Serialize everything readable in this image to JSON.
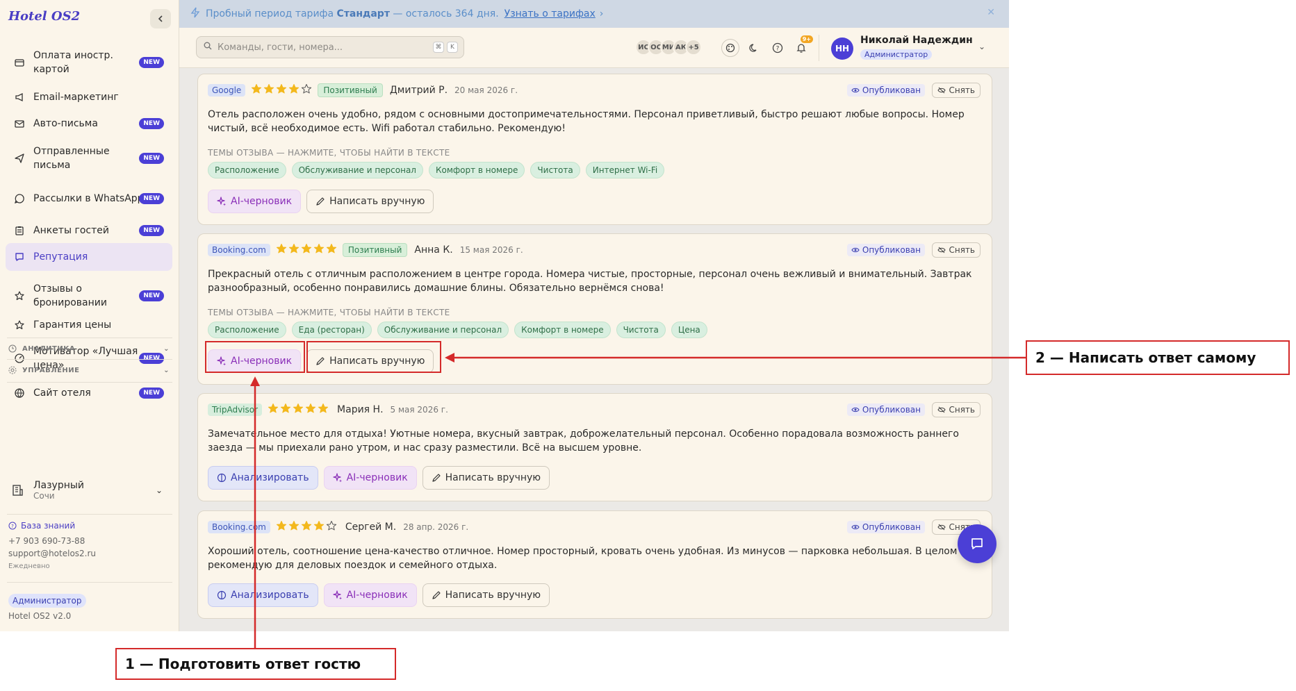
{
  "app": {
    "brand": "Hotel OS2"
  },
  "sidebar": {
    "items": [
      {
        "label": "Оплата иностр. картой",
        "icon": "credit-card-icon",
        "new": true
      },
      {
        "label": "Email-маркетинг",
        "icon": "megaphone-icon",
        "new": false
      },
      {
        "label": "Авто-письма",
        "icon": "mail-icon",
        "new": true
      },
      {
        "label": "Отправленные письма",
        "icon": "send-icon",
        "new": true
      },
      {
        "label": "Рассылки в WhatsApp",
        "icon": "chat-bubble-icon",
        "new": true
      },
      {
        "label": "Анкеты гостей",
        "icon": "clipboard-icon",
        "new": true
      },
      {
        "label": "Репутация",
        "icon": "message-square-icon",
        "new": false,
        "active": true
      },
      {
        "label": "Отзывы о бронировании",
        "icon": "star-icon",
        "new": true
      },
      {
        "label": "Гарантия цены",
        "icon": "star-outline-icon",
        "new": false
      },
      {
        "label": "Мотиватор «Лучшая цена»",
        "icon": "gauge-icon",
        "new": true
      },
      {
        "label": "Сайт отеля",
        "icon": "globe-icon",
        "new": true
      }
    ],
    "new_badge": "NEW",
    "sections": {
      "analytics": "АНАЛИТИКА",
      "management": "УПРАВЛЕНИЕ"
    },
    "hotel": {
      "name": "Лазурный",
      "city": "Сочи"
    },
    "footer": {
      "kb_link": "База знаний",
      "phone": "+7 903 690-73-88",
      "email": "support@hotelos2.ru",
      "hours": "Ежедневно",
      "role": "Администратор",
      "version": "Hotel OS2 v2.0"
    }
  },
  "banner": {
    "prefix": "Пробный период тарифа",
    "plan": "Стандарт",
    "suffix": "— осталось 364 дня.",
    "link": "Узнать о тарифах",
    "link_arrow": "›"
  },
  "topbar": {
    "search_placeholder": "Команды, гости, номера...",
    "kbd1": "⌘",
    "kbd2": "K",
    "avatars": [
      "ИС",
      "ОС",
      "МИ",
      "АК",
      "+5"
    ],
    "notif_badge": "9+",
    "user": {
      "initials": "НН",
      "name": "Николай Надеждин",
      "role": "Администратор"
    }
  },
  "labels": {
    "status": "Опубликован",
    "unpublish": "Снять",
    "themes": "ТЕМЫ ОТЗЫВА — НАЖМИТЕ, ЧТОБЫ НАЙТИ В ТЕКСТЕ",
    "ai_draft": "AI-черновик",
    "manual": "Написать вручную",
    "analyze": "Анализировать"
  },
  "reviews": [
    {
      "source": "Google",
      "rating": 4,
      "sentiment": "Позитивный",
      "author": "Дмитрий Р.",
      "date": "20 мая 2026 г.",
      "text": "Отель расположен очень удобно, рядом с основными достопримечательностями. Персонал приветливый, быстро решают любые вопросы. Номер чистый, всё необходимое есть. Wifi работал стабильно. Рекомендую!",
      "tags": [
        "Расположение",
        "Обслуживание и персонал",
        "Комфорт в номере",
        "Чистота",
        "Интернет Wi-Fi"
      ]
    },
    {
      "source": "Booking.com",
      "rating": 5,
      "sentiment": "Позитивный",
      "author": "Анна К.",
      "date": "15 мая 2026 г.",
      "text": "Прекрасный отель с отличным расположением в центре города. Номера чистые, просторные, персонал очень вежливый и внимательный. Завтрак разнообразный, особенно понравились домашние блины. Обязательно вернёмся снова!",
      "tags": [
        "Расположение",
        "Еда (ресторан)",
        "Обслуживание и персонал",
        "Комфорт в номере",
        "Чистота",
        "Цена"
      ]
    },
    {
      "source": "TripAdvisor",
      "rating": 5,
      "sentiment": "",
      "author": "Мария Н.",
      "date": "5 мая 2026 г.",
      "text": "Замечательное место для отдыха! Уютные номера, вкусный завтрак, доброжелательный персонал. Особенно порадовала возможность раннего заезда — мы приехали рано утром, и нас сразу разместили. Всё на высшем уровне.",
      "tags": []
    },
    {
      "source": "Booking.com",
      "rating": 4,
      "sentiment": "",
      "author": "Сергей М.",
      "date": "28 апр. 2026 г.",
      "text": "Хороший отель, соотношение цена-качество отличное. Номер просторный, кровать очень удобная. Из минусов — парковка небольшая. В целом рекомендую для деловых поездок и семейного отдыха.",
      "tags": []
    }
  ],
  "annotations": {
    "callout1": "1 — Подготовить ответ гостю",
    "callout2": "2 — Написать ответ самому"
  },
  "colors": {
    "accent": "#4b3fd6",
    "annotation": "#d42a2a",
    "star": "#f3b81c"
  }
}
